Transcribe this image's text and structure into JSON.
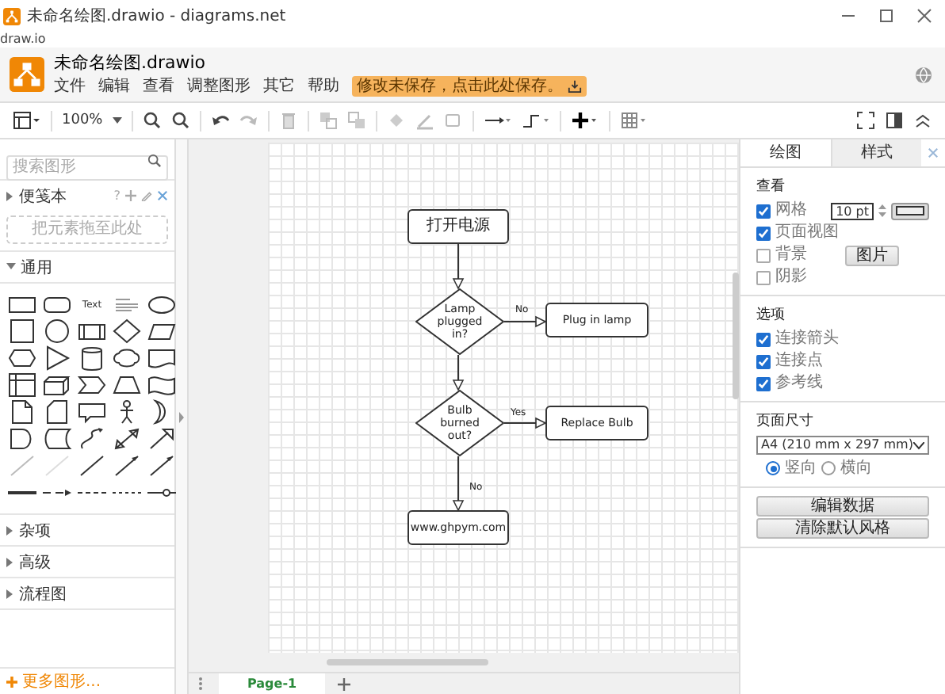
{
  "window": {
    "title": "未命名绘图.drawio - diagrams.net"
  },
  "address": "draw.io",
  "header": {
    "filename": "未命名绘图.drawio",
    "menu": [
      "文件",
      "编辑",
      "查看",
      "调整图形",
      "其它",
      "帮助"
    ],
    "save_notice": "修改未保存，点击此处保存。"
  },
  "toolbar": {
    "zoom": "100%"
  },
  "sidebar": {
    "search": {
      "placeholder": "搜索图形"
    },
    "scratchpad": {
      "title": "便笺本",
      "help": "?",
      "drop_hint": "把元素拖至此处"
    },
    "general": {
      "title": "通用",
      "text_shape": "Text"
    },
    "sections": [
      "杂项",
      "高级",
      "流程图"
    ],
    "more_shapes": "更多图形..."
  },
  "diagram": {
    "nodes": [
      {
        "kind": "process",
        "text": "打开电源"
      },
      {
        "kind": "decision",
        "text": "Lamp plugged in?"
      },
      {
        "kind": "process",
        "text": "Plug in lamp"
      },
      {
        "kind": "decision",
        "text": "Bulb burned out?"
      },
      {
        "kind": "process",
        "text": "Replace Bulb"
      },
      {
        "kind": "process",
        "text": "www.ghpym.com"
      }
    ],
    "edge_labels": [
      "No",
      "Yes",
      "No"
    ]
  },
  "pages": [
    {
      "label": "Page-1",
      "selected": true
    }
  ],
  "format_panel": {
    "tabs": [
      {
        "label": "绘图",
        "selected": true
      },
      {
        "label": "样式",
        "selected": false
      }
    ],
    "view": {
      "title": "查看",
      "options": [
        {
          "label": "网格",
          "checked": true
        },
        {
          "label": "页面视图",
          "checked": true
        },
        {
          "label": "背景",
          "checked": false
        },
        {
          "label": "阴影",
          "checked": false
        }
      ],
      "grid_size": "10 pt",
      "image_button": "图片"
    },
    "options": {
      "title": "选项",
      "items": [
        {
          "label": "连接箭头",
          "checked": true
        },
        {
          "label": "连接点",
          "checked": true
        },
        {
          "label": "参考线",
          "checked": true
        }
      ]
    },
    "paper": {
      "title": "页面尺寸",
      "size": "A4 (210 mm x 297 mm)",
      "orientations": [
        {
          "label": "竖向",
          "selected": true
        },
        {
          "label": "横向",
          "selected": false
        }
      ]
    },
    "buttons": [
      "编辑数据",
      "清除默认风格"
    ]
  }
}
